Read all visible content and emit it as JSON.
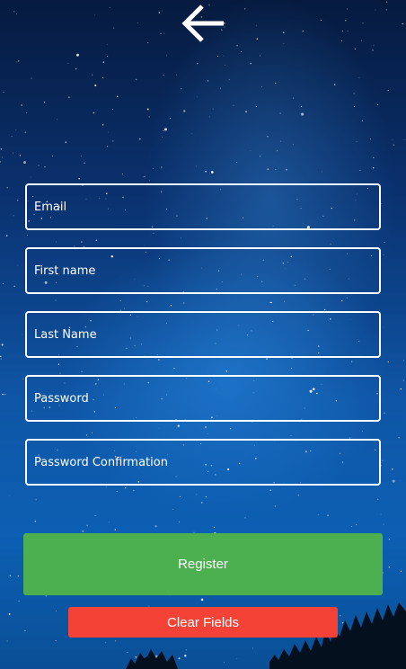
{
  "header": {
    "back_icon": "arrow-left-icon"
  },
  "form": {
    "email_placeholder": "Email",
    "first_name_placeholder": "First name",
    "last_name_placeholder": "Last Name",
    "password_placeholder": "Password",
    "password_confirmation_placeholder": "Password Confirmation"
  },
  "actions": {
    "register_label": "Register",
    "clear_label": "Clear Fields"
  },
  "colors": {
    "register": "#4caf50",
    "clear": "#f44336",
    "field_border": "#ffffff"
  }
}
